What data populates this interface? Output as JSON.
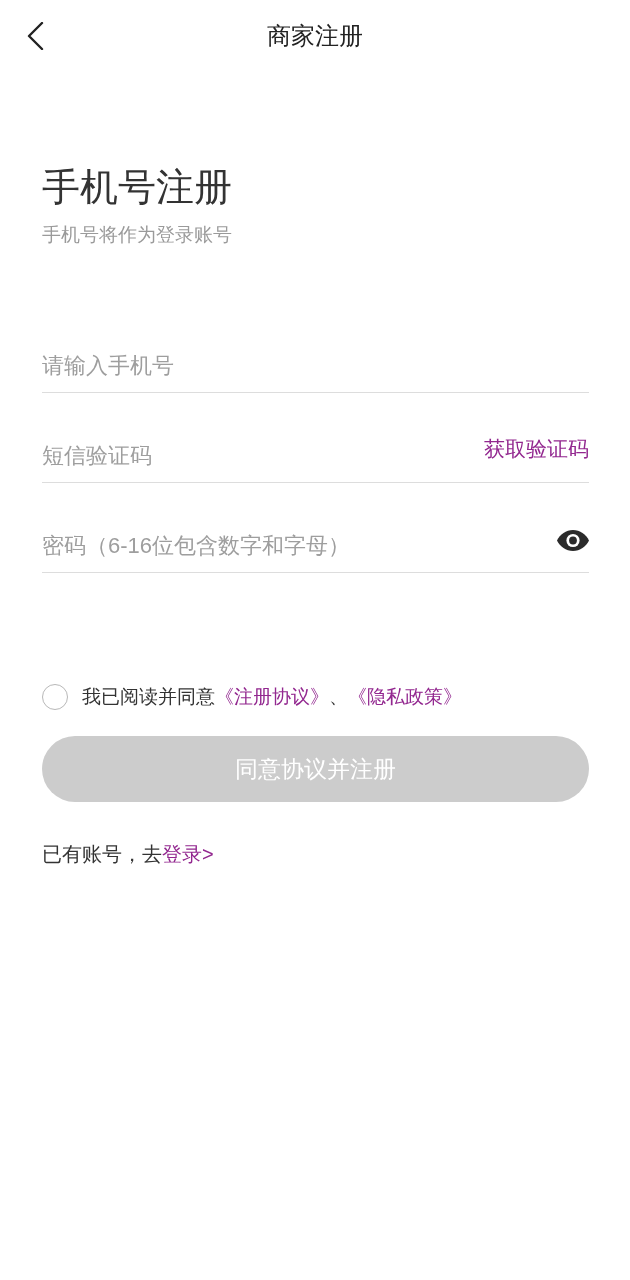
{
  "header": {
    "title": "商家注册"
  },
  "intro": {
    "heading": "手机号注册",
    "subtitle": "手机号将作为登录账号"
  },
  "fields": [
    {
      "kind": "phone",
      "placeholder": "请输入手机号"
    },
    {
      "kind": "sms",
      "placeholder": "短信验证码",
      "action": "获取验证码"
    },
    {
      "kind": "password",
      "placeholder": "密码（6-16位包含数字和字母）"
    }
  ],
  "agreement": {
    "checked": false,
    "text": "我已阅读并同意",
    "links": [
      "《注册协议》",
      "《隐私政策》"
    ],
    "separator": "、"
  },
  "submit": {
    "label": "同意协议并注册",
    "disabled": true
  },
  "login_prompt": {
    "text": "已有账号，去",
    "link": "登录>"
  }
}
